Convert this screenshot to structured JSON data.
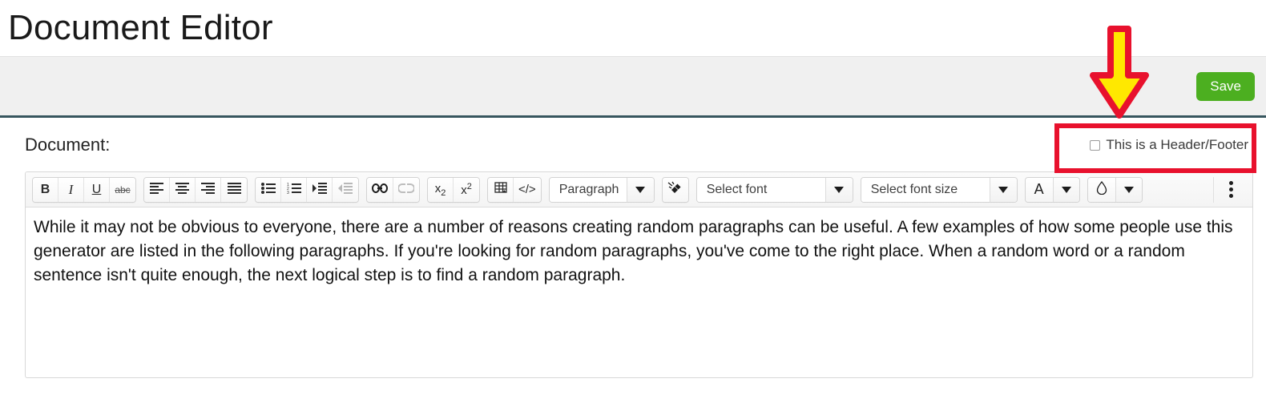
{
  "page": {
    "title": "Document Editor"
  },
  "action_bar": {
    "save_label": "Save"
  },
  "document_section": {
    "label": "Document:",
    "header_footer_checkbox": {
      "label": "This is a Header/Footer",
      "checked": false
    }
  },
  "toolbar": {
    "groups": [
      {
        "name": "text-style",
        "buttons": [
          {
            "name": "bold-button",
            "glyph": "B",
            "disabled": false
          },
          {
            "name": "italic-button",
            "glyph": "I",
            "disabled": false
          },
          {
            "name": "underline-button",
            "glyph": "U",
            "disabled": false
          },
          {
            "name": "strikethrough-button",
            "glyph": "abc",
            "disabled": false
          }
        ]
      },
      {
        "name": "alignment",
        "buttons": [
          {
            "name": "align-left-button",
            "glyph": "align-left-icon",
            "disabled": false
          },
          {
            "name": "align-center-button",
            "glyph": "align-center-icon",
            "disabled": false
          },
          {
            "name": "align-right-button",
            "glyph": "align-right-icon",
            "disabled": false
          },
          {
            "name": "align-justify-button",
            "glyph": "align-justify-icon",
            "disabled": false
          }
        ]
      },
      {
        "name": "lists-indent",
        "buttons": [
          {
            "name": "bullet-list-button",
            "glyph": "bullet-list-icon",
            "disabled": false
          },
          {
            "name": "numbered-list-button",
            "glyph": "numbered-list-icon",
            "disabled": false
          },
          {
            "name": "increase-indent-button",
            "glyph": "indent-increase-icon",
            "disabled": false
          },
          {
            "name": "decrease-indent-button",
            "glyph": "indent-decrease-icon",
            "disabled": true
          }
        ]
      },
      {
        "name": "link",
        "buttons": [
          {
            "name": "insert-link-button",
            "glyph": "link-icon",
            "disabled": false
          },
          {
            "name": "remove-link-button",
            "glyph": "unlink-icon",
            "disabled": true
          }
        ]
      },
      {
        "name": "script",
        "buttons": [
          {
            "name": "subscript-button",
            "glyph": "x₂",
            "disabled": false
          },
          {
            "name": "superscript-button",
            "glyph": "x²",
            "disabled": false
          }
        ]
      },
      {
        "name": "insert",
        "buttons": [
          {
            "name": "insert-table-button",
            "glyph": "table-icon",
            "disabled": false
          },
          {
            "name": "source-code-button",
            "glyph": "</>",
            "disabled": false
          }
        ]
      }
    ],
    "paragraph_select": {
      "name": "paragraph-style-select",
      "value": "Paragraph"
    },
    "clear_formatting_button": {
      "name": "clear-formatting-button",
      "glyph": "eraser-icon"
    },
    "font_select": {
      "name": "font-family-select",
      "value": "Select font"
    },
    "font_size_select": {
      "name": "font-size-select",
      "value": "Select font size"
    },
    "text_color_button": {
      "name": "text-color-button",
      "glyph": "A"
    },
    "highlight_color_button": {
      "name": "highlight-color-button",
      "glyph": "droplet-icon"
    },
    "more_button": {
      "name": "toolbar-more-button",
      "glyph": "vertical-ellipsis-icon"
    }
  },
  "editor": {
    "content": "While it may not be obvious to everyone, there are a number of reasons creating random paragraphs can be useful. A few examples of how some people use this generator are listed in the following paragraphs.  If you're looking for random paragraphs, you've come to the right place. When a random word or a random sentence isn't quite enough, the next logical step is to find a random paragraph."
  },
  "annotations": {
    "highlight_box_color": "#e8112d",
    "arrow_fill_color": "#ffe800",
    "arrow_stroke_color": "#e8112d"
  },
  "colors": {
    "save_green": "#4caf20",
    "bar_grey": "#f0f0f0",
    "rule_teal": "#37565e"
  }
}
